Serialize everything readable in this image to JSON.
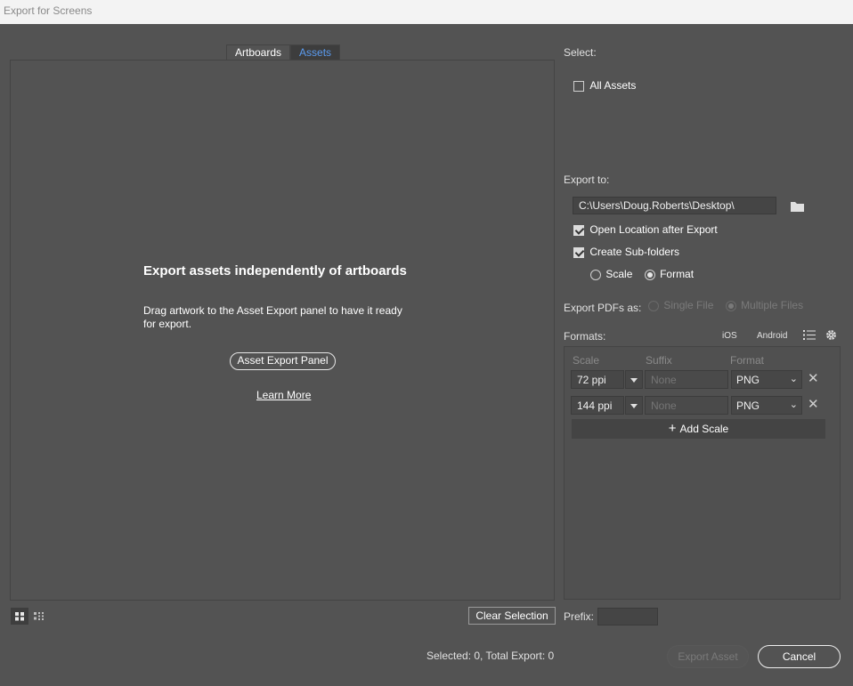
{
  "window": {
    "title": "Export for Screens"
  },
  "tabs": [
    {
      "label": "Artboards",
      "active": false
    },
    {
      "label": "Assets",
      "active": true
    }
  ],
  "empty_state": {
    "title": "Export assets independently of artboards",
    "description": "Drag artwork to the Asset Export panel to have it ready for export.",
    "panel_button": "Asset Export Panel",
    "learn_more": "Learn More"
  },
  "select": {
    "label": "Select:",
    "all_assets": {
      "label": "All Assets",
      "checked": false
    }
  },
  "export_to": {
    "label": "Export to:",
    "path": "C:\\Users\\Doug.Roberts\\Desktop\\",
    "folder_icon": "folder-icon",
    "open_location": {
      "label": "Open Location after Export",
      "checked": true
    },
    "sub_folders": {
      "label": "Create Sub-folders",
      "checked": true
    },
    "sub_folder_mode": {
      "scale": "Scale",
      "format": "Format",
      "selected": "Format"
    }
  },
  "export_pdfs": {
    "label": "Export PDFs as:",
    "single": "Single File",
    "multiple": "Multiple Files",
    "selected": "Multiple Files",
    "enabled": false
  },
  "formats": {
    "label": "Formats:",
    "ios": "iOS",
    "android": "Android",
    "headers": {
      "scale": "Scale",
      "suffix": "Suffix",
      "format": "Format"
    },
    "rows": [
      {
        "scale": "72 ppi",
        "suffix_placeholder": "None",
        "format": "PNG"
      },
      {
        "scale": "144 ppi",
        "suffix_placeholder": "None",
        "format": "PNG"
      }
    ],
    "add_scale": "Add Scale"
  },
  "bottom": {
    "clear_selection": "Clear Selection",
    "prefix_label": "Prefix:",
    "prefix_value": "",
    "status": "Selected: 0, Total Export: 0",
    "export_button": "Export Asset",
    "cancel_button": "Cancel"
  },
  "colors": {
    "background": "#535353",
    "active_tab_text": "#5b9bef",
    "titlebar": "#f3f3f3"
  }
}
